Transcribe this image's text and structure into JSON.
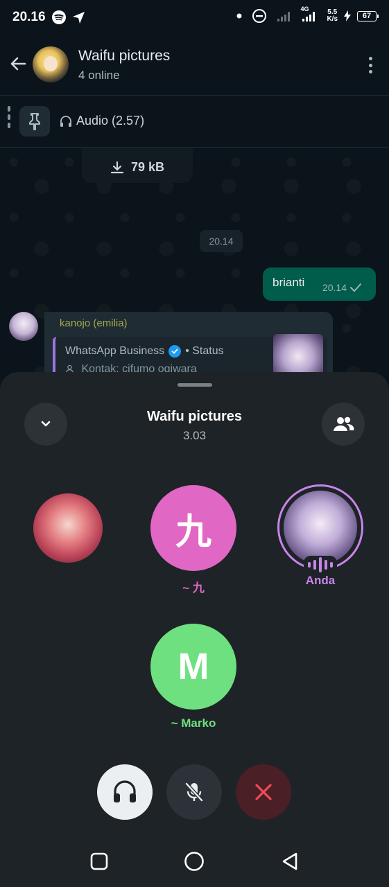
{
  "status": {
    "time": "20.16",
    "net_type": "4G",
    "net_speed": "5.5",
    "net_speed_unit": "K/s",
    "battery": "67"
  },
  "header": {
    "title": "Waifu pictures",
    "subtitle": "4 online"
  },
  "pinned": {
    "text": "Audio (2.57)"
  },
  "chat": {
    "download_size": "79 kB",
    "date_chip": "20.14",
    "outgoing": {
      "text": "brianti",
      "time": "20.14"
    },
    "incoming": {
      "sender": "kanojo (emilia)",
      "quote_title": "WhatsApp Business",
      "quote_status": "• Status",
      "quote_line": "Kontak: cifumo ogiwara"
    }
  },
  "voice_chat": {
    "title": "Waifu pictures",
    "duration": "3.03",
    "participants": [
      {
        "initial": "",
        "name": "",
        "color": "#ff9a8a"
      },
      {
        "initial": "九",
        "name": "~ 九",
        "color": "#e067c3"
      },
      {
        "initial": "",
        "name": "Anda",
        "color": "#c785e8"
      },
      {
        "initial": "M",
        "name": "~ Marko",
        "color": "#6fe07f"
      }
    ]
  },
  "icons": {
    "back": "arrow-left-icon",
    "more": "more-vertical-icon",
    "pin": "pin-icon",
    "audio": "headphones-icon",
    "download": "download-icon",
    "collapse": "chevron-down-icon",
    "participants": "people-icon",
    "speaker": "headphones-icon",
    "mic": "mic-off-icon",
    "end": "close-icon"
  },
  "colors": {
    "accent_purple": "#c785e8",
    "pink": "#e067c3",
    "green": "#6fe07f",
    "end_call": "#ef4b5a",
    "outgoing_bubble": "#005c4b"
  }
}
